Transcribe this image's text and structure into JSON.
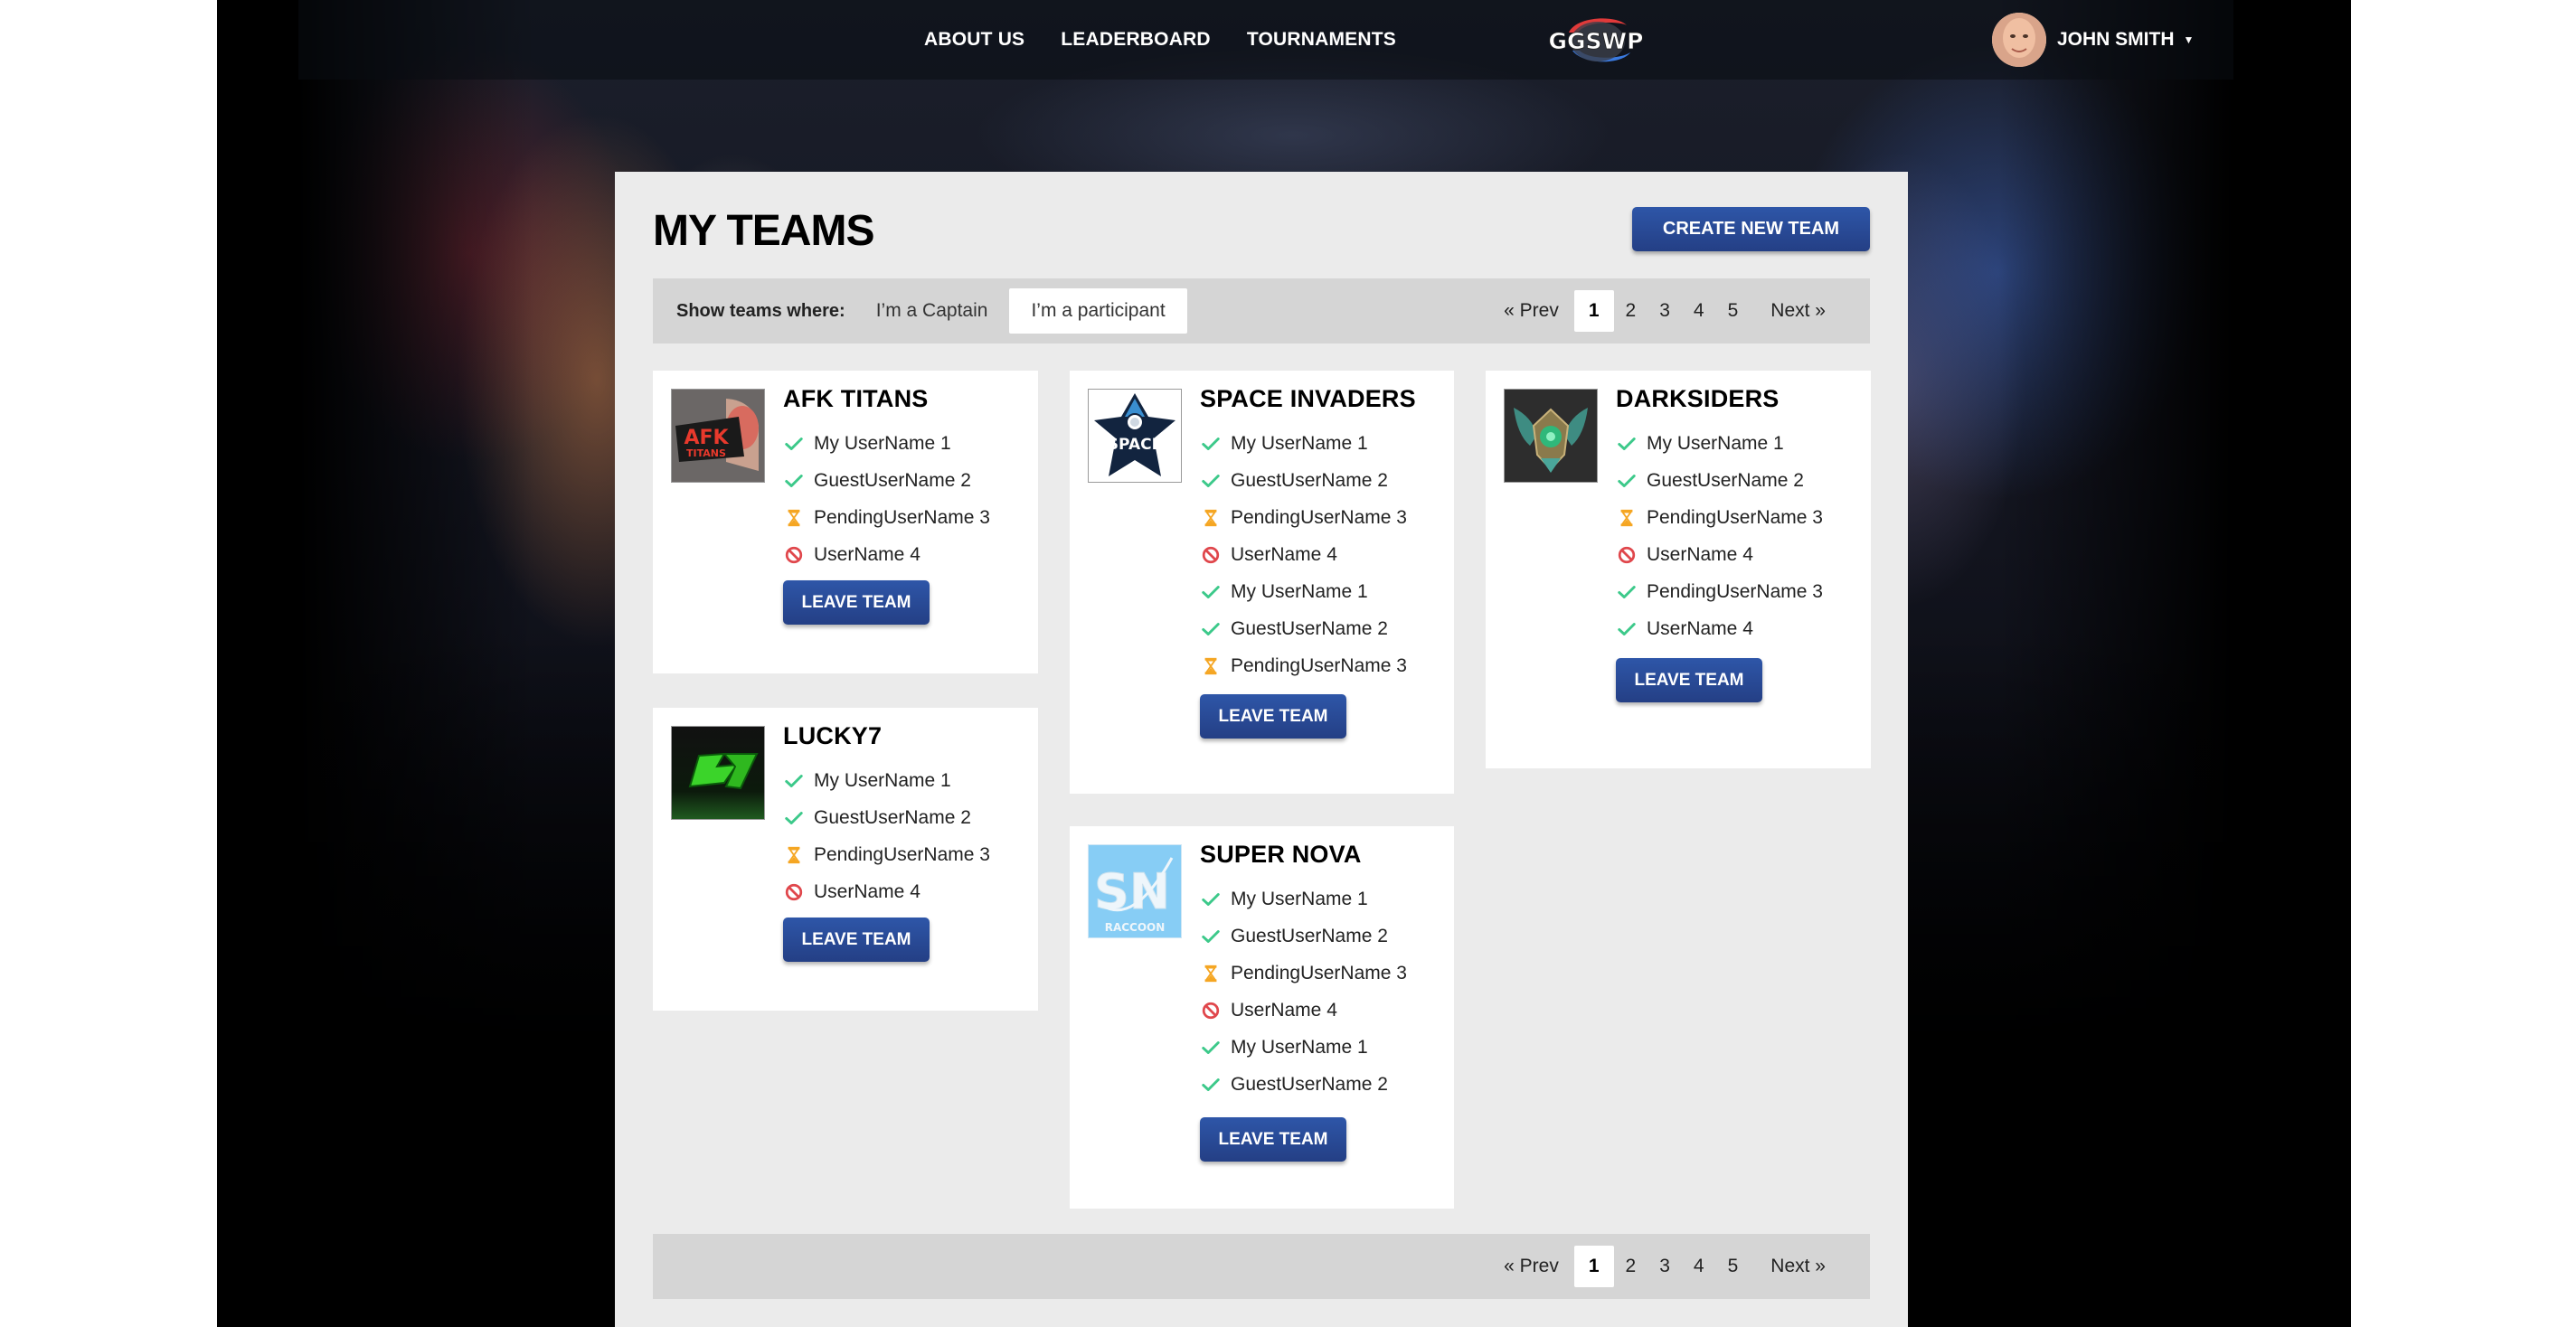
{
  "nav": {
    "links": [
      "ABOUT US",
      "LEADERBOARD",
      "TOURNAMENTS"
    ],
    "logo_text": "GGSWP",
    "user_name": "JOHN SMITH"
  },
  "page": {
    "title": "MY TEAMS",
    "create_button": "CREATE NEW TEAM"
  },
  "filter": {
    "label": "Show teams where:",
    "options": [
      "I’m a Captain",
      "I’m a participant"
    ],
    "selected": "I’m a participant"
  },
  "pagination": {
    "prev": "« Prev",
    "pages": [
      "1",
      "2",
      "3",
      "4",
      "5"
    ],
    "current": "1",
    "next": "Next »"
  },
  "status_colors": {
    "accepted": "#3cc98a",
    "pending": "#f5a623",
    "declined": "#e0474c",
    "button": "#2a4d9c"
  },
  "teams": [
    {
      "name": "AFK TITANS",
      "logo": "afk-titans-logo",
      "leave_label": "LEAVE TEAM",
      "members": [
        {
          "name": "My UserName 1",
          "status": "accepted"
        },
        {
          "name": "GuestUserName 2",
          "status": "accepted"
        },
        {
          "name": "PendingUserName 3",
          "status": "pending"
        },
        {
          "name": "UserName 4",
          "status": "declined"
        }
      ]
    },
    {
      "name": "LUCKY7",
      "logo": "lucky7-logo",
      "leave_label": "LEAVE TEAM",
      "members": [
        {
          "name": "My UserName 1",
          "status": "accepted"
        },
        {
          "name": "GuestUserName 2",
          "status": "accepted"
        },
        {
          "name": "PendingUserName 3",
          "status": "pending"
        },
        {
          "name": "UserName 4",
          "status": "declined"
        }
      ]
    },
    {
      "name": "SPACE INVADERS",
      "logo": "space-invaders-logo",
      "leave_label": "LEAVE TEAM",
      "members": [
        {
          "name": "My UserName 1",
          "status": "accepted"
        },
        {
          "name": "GuestUserName 2",
          "status": "accepted"
        },
        {
          "name": "PendingUserName 3",
          "status": "pending"
        },
        {
          "name": "UserName 4",
          "status": "declined"
        },
        {
          "name": "My UserName 1",
          "status": "accepted"
        },
        {
          "name": "GuestUserName 2",
          "status": "accepted"
        },
        {
          "name": "PendingUserName 3",
          "status": "pending"
        }
      ]
    },
    {
      "name": "SUPER NOVA",
      "logo": "super-nova-logo",
      "logo_caption": "RACCOON",
      "leave_label": "LEAVE TEAM",
      "members": [
        {
          "name": "My UserName 1",
          "status": "accepted"
        },
        {
          "name": "GuestUserName 2",
          "status": "accepted"
        },
        {
          "name": "PendingUserName 3",
          "status": "pending"
        },
        {
          "name": "UserName 4",
          "status": "declined"
        },
        {
          "name": "My UserName 1",
          "status": "accepted"
        },
        {
          "name": "GuestUserName 2",
          "status": "accepted"
        }
      ]
    },
    {
      "name": "DARKSIDERS",
      "logo": "darksiders-logo",
      "leave_label": "LEAVE TEAM",
      "members": [
        {
          "name": "My UserName 1",
          "status": "accepted"
        },
        {
          "name": "GuestUserName 2",
          "status": "accepted"
        },
        {
          "name": "PendingUserName 3",
          "status": "pending"
        },
        {
          "name": "UserName 4",
          "status": "declined"
        },
        {
          "name": "PendingUserName 3",
          "status": "accepted"
        },
        {
          "name": "UserName 4",
          "status": "accepted"
        }
      ]
    }
  ]
}
